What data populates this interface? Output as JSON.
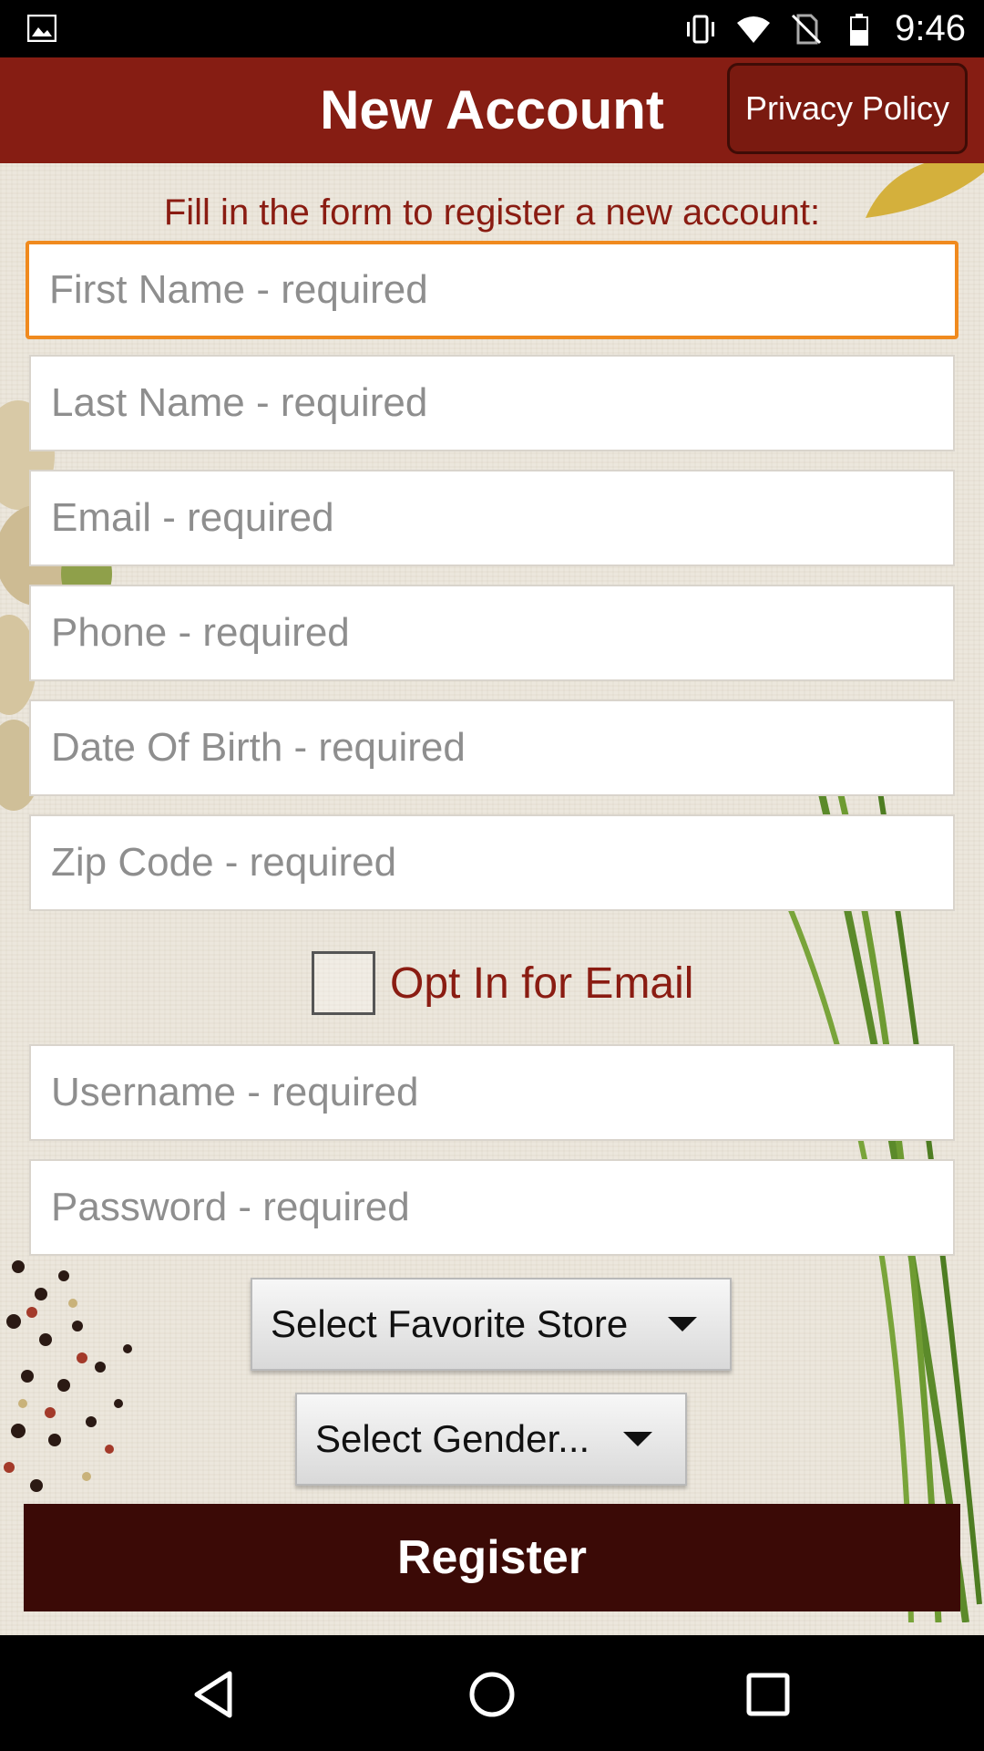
{
  "status_bar": {
    "time": "9:46",
    "icons": [
      "image-notification-icon",
      "vibrate-icon",
      "wifi-icon",
      "no-sim-icon",
      "battery-icon"
    ]
  },
  "app_bar": {
    "title": "New Account",
    "privacy_label": "Privacy Policy"
  },
  "form": {
    "instructions": "Fill in the form to register a new account:",
    "first_name_placeholder": "First Name - required",
    "last_name_placeholder": "Last Name - required",
    "email_placeholder": "Email - required",
    "phone_placeholder": "Phone - required",
    "dob_placeholder": "Date Of Birth - required",
    "zip_placeholder": "Zip Code - required",
    "optin_label": "Opt In for Email",
    "optin_checked": false,
    "username_placeholder": "Username - required",
    "password_placeholder": "Password - required",
    "store_select": "Select Favorite Store",
    "gender_select": "Select Gender...",
    "register_label": "Register"
  },
  "colors": {
    "app_bar": "#861d13",
    "accent_text": "#8a1c12",
    "focus_border": "#f08a1e",
    "register_button": "#3b0a06"
  },
  "nav_bar": {
    "icons": [
      "back-icon",
      "home-icon",
      "recents-icon"
    ]
  }
}
